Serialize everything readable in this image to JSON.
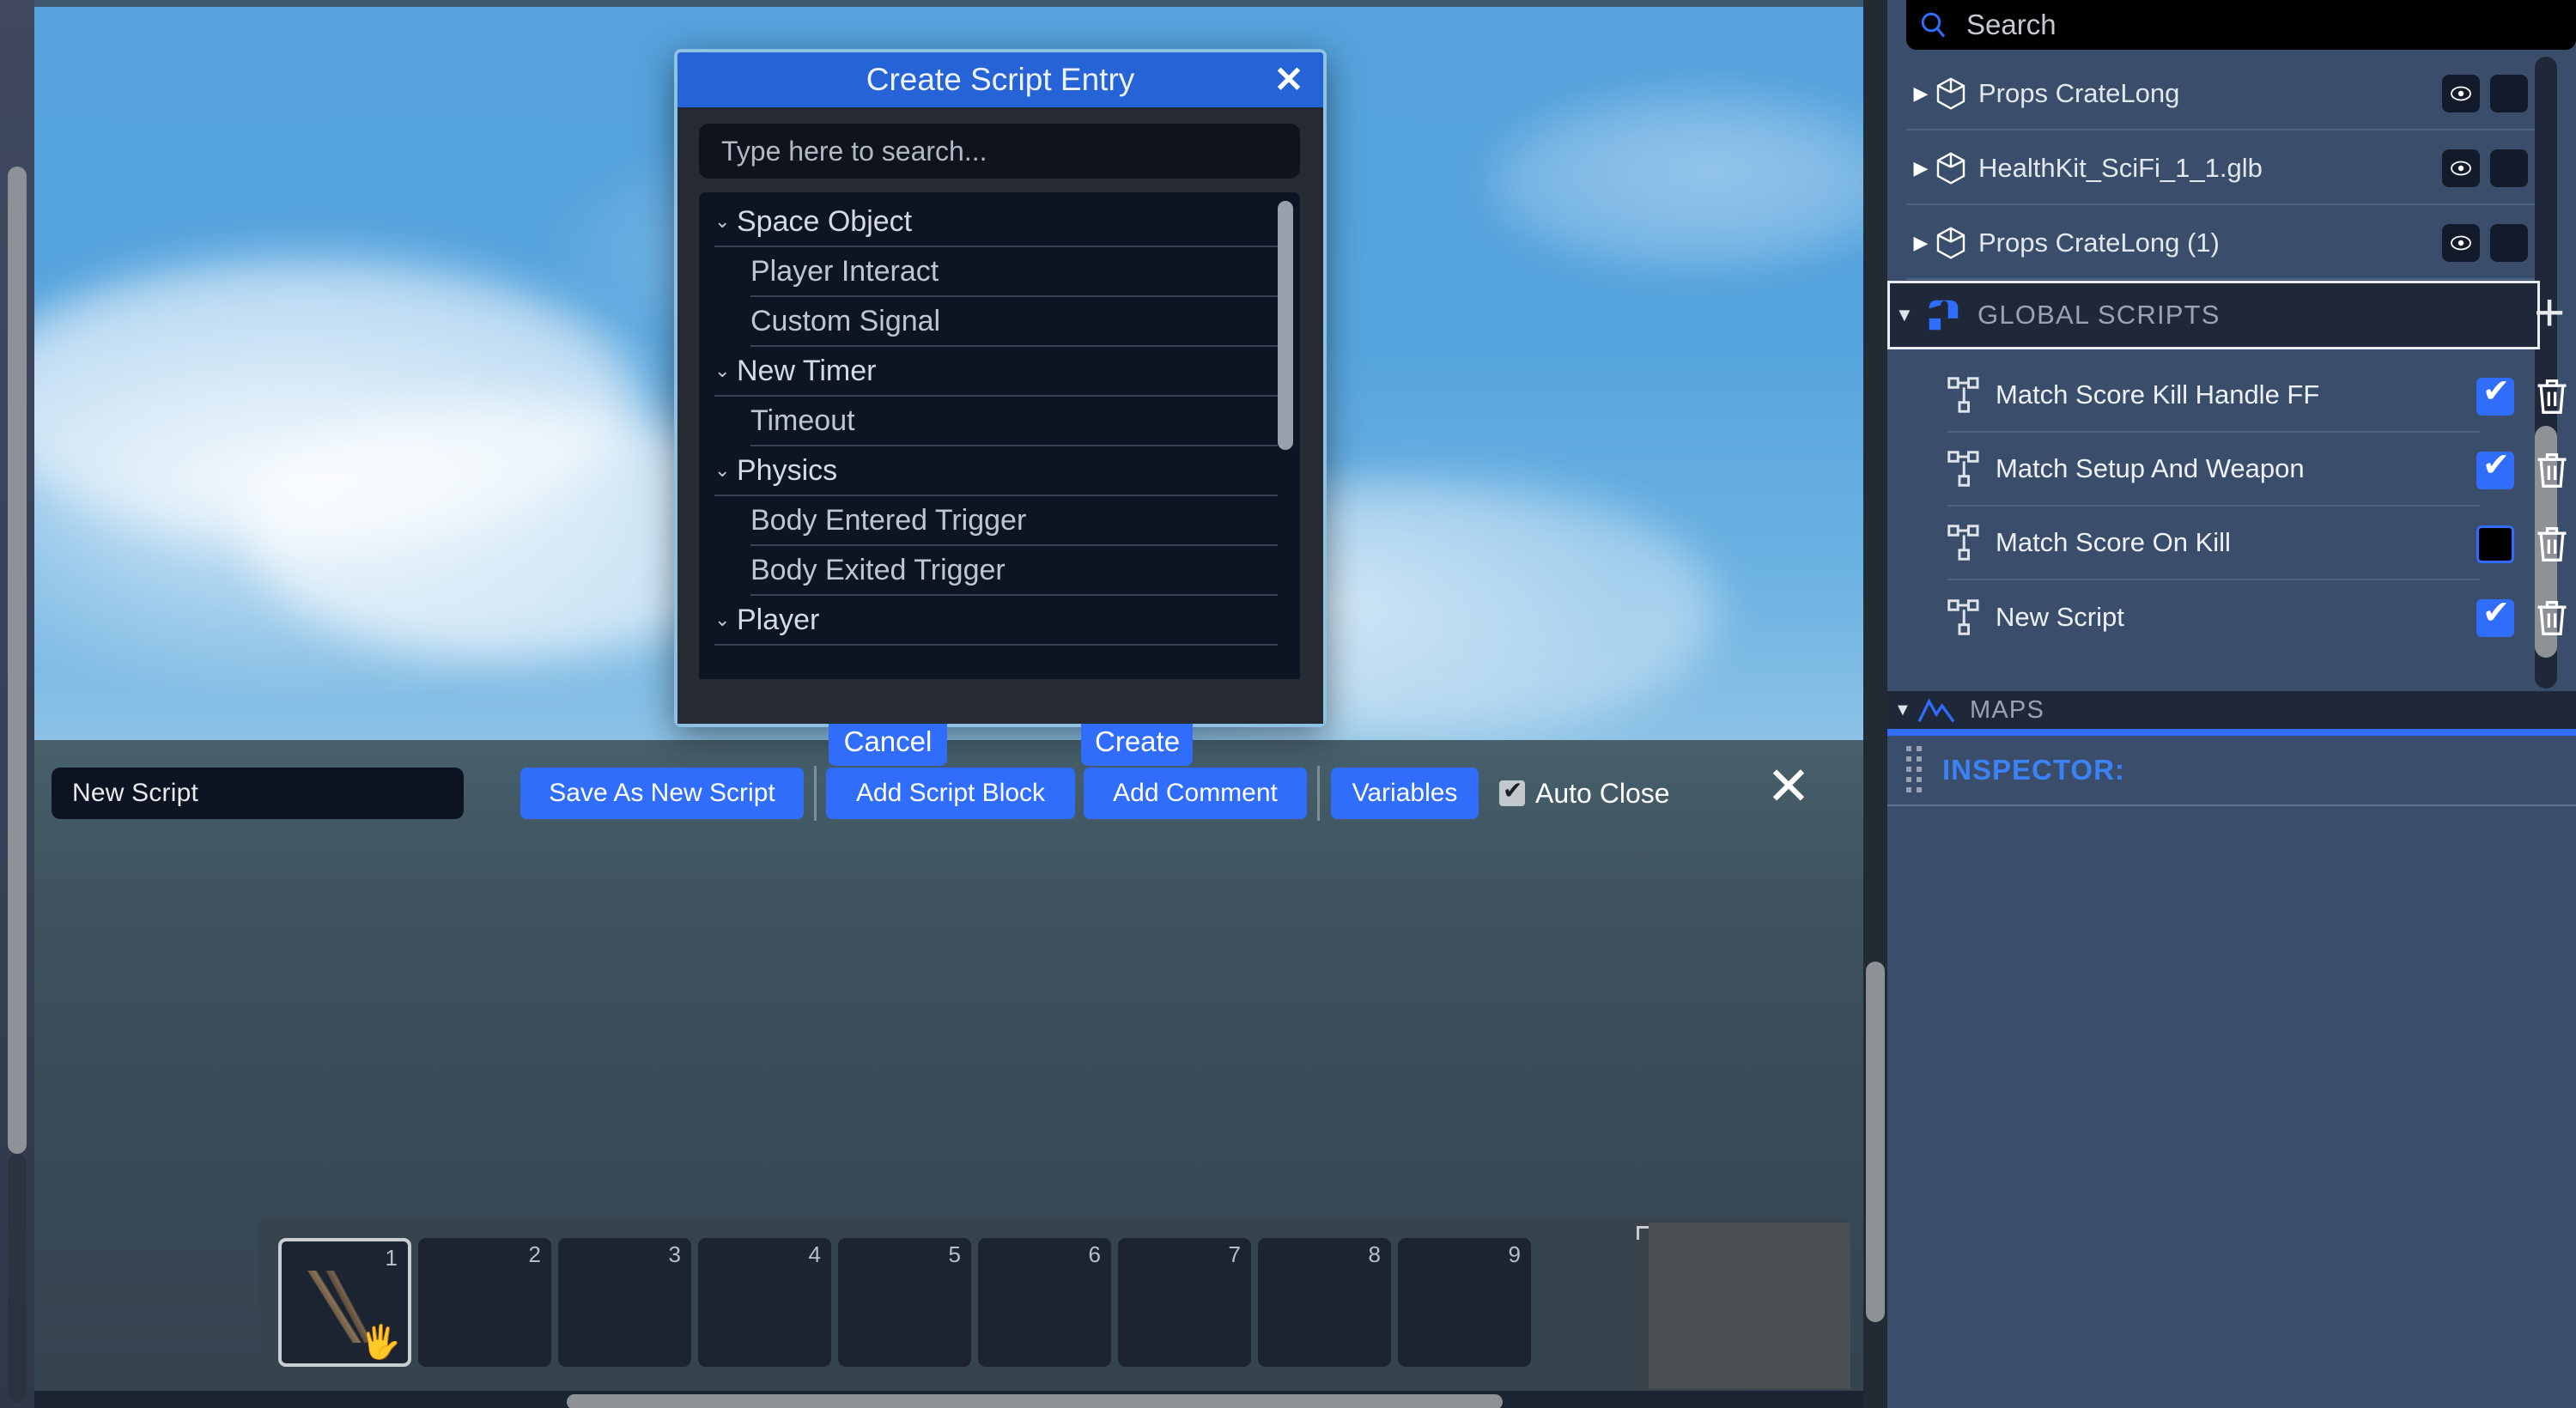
{
  "modal": {
    "title": "Create Script Entry",
    "close_icon": "close-icon",
    "search_placeholder": "Type here to search...",
    "list": [
      {
        "kind": "category",
        "label": "Space Object",
        "chevron": "chevron-down-icon"
      },
      {
        "kind": "item",
        "label": "Player Interact"
      },
      {
        "kind": "item",
        "label": "Custom Signal"
      },
      {
        "kind": "category",
        "label": "New Timer",
        "chevron": "chevron-down-icon"
      },
      {
        "kind": "item",
        "label": "Timeout"
      },
      {
        "kind": "category",
        "label": "Physics",
        "chevron": "chevron-down-icon"
      },
      {
        "kind": "item",
        "label": "Body Entered Trigger"
      },
      {
        "kind": "item",
        "label": "Body Exited Trigger"
      },
      {
        "kind": "category",
        "label": "Player",
        "chevron": "chevron-down-icon"
      }
    ],
    "cancel_label": "Cancel",
    "create_label": "Create"
  },
  "editor": {
    "script_name": "New Script",
    "buttons": [
      {
        "label": "Save As New Script"
      },
      {
        "label": "Add Script Block"
      },
      {
        "label": "Add Comment"
      },
      {
        "label": "Variables"
      }
    ],
    "auto_close_label": "Auto Close",
    "auto_close_checked": true,
    "close_icon": "close-icon"
  },
  "hotbar": {
    "slots": [
      {
        "num": "1",
        "selected": true,
        "item": "weapon-rifle",
        "overlay": "hand-icon"
      },
      {
        "num": "2",
        "selected": false,
        "item": ""
      },
      {
        "num": "3",
        "selected": false,
        "item": ""
      },
      {
        "num": "4",
        "selected": false,
        "item": ""
      },
      {
        "num": "5",
        "selected": false,
        "item": ""
      },
      {
        "num": "6",
        "selected": false,
        "item": ""
      },
      {
        "num": "7",
        "selected": false,
        "item": ""
      },
      {
        "num": "8",
        "selected": false,
        "item": ""
      },
      {
        "num": "9",
        "selected": false,
        "item": ""
      }
    ]
  },
  "right_panel": {
    "search": {
      "placeholder": "Search",
      "icon": "search-icon"
    },
    "hierarchy": [
      {
        "label": "Props CrateLong",
        "arrow": "chevron-right-icon",
        "icon": "cube-icon",
        "eye": "eye-icon",
        "has_script_flag": false
      },
      {
        "label": "HealthKit_SciFi_1_1.glb",
        "arrow": "chevron-right-icon",
        "icon": "cube-icon",
        "eye": "eye-icon",
        "has_script_flag": true
      },
      {
        "label": "Props CrateLong (1)",
        "arrow": "chevron-right-icon",
        "icon": "cube-icon",
        "eye": "eye-icon",
        "has_script_flag": false
      }
    ],
    "global_scripts": {
      "label": "GLOBAL SCRIPTS",
      "caret": "caret-down-icon",
      "icon": "script-flag-icon",
      "add_icon": "plus-icon",
      "scripts": [
        {
          "label": "Match Score Kill Handle FF",
          "enabled": true,
          "icon": "node-graph-icon",
          "delete_icon": "trash-icon"
        },
        {
          "label": "Match Setup And Weapon",
          "enabled": true,
          "icon": "node-graph-icon",
          "delete_icon": "trash-icon"
        },
        {
          "label": "Match Score On Kill",
          "enabled": false,
          "icon": "node-graph-icon",
          "delete_icon": "trash-icon"
        },
        {
          "label": "New Script",
          "enabled": true,
          "icon": "node-graph-icon",
          "delete_icon": "trash-icon"
        }
      ]
    },
    "maps": {
      "label": "MAPS",
      "caret": "caret-down-icon",
      "icon": "mountains-icon"
    },
    "inspector": {
      "label": "INSPECTOR:",
      "grip": "grip-dots-icon"
    }
  },
  "colors": {
    "accent_blue": "#2f6dfa",
    "header_blue": "#2563d6",
    "panel_bg": "#3a4e6b",
    "dark_bg": "#1f2838",
    "inspector_text": "#3b82f6"
  }
}
